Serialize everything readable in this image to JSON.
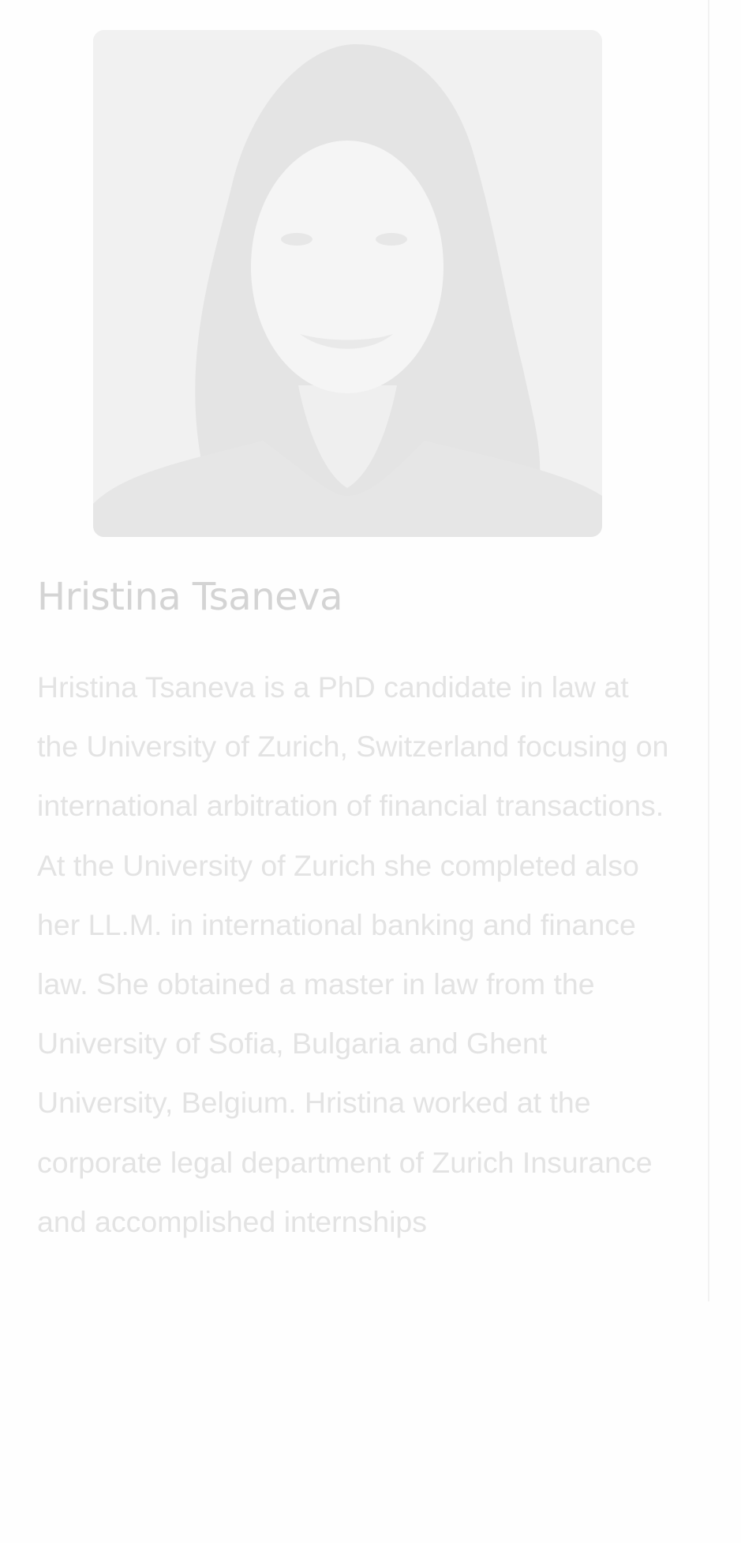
{
  "profile": {
    "photo_alt": "Portrait of Hristina Tsaneva",
    "name": "Hristina Tsaneva",
    "bio": "Hristina Tsaneva is a PhD candidate in law at the University of Zurich, Switzerland focusing on international arbitration of financial transactions. At the University of Zurich she completed also her LL.M. in international banking and finance law. She obtained a master in law from the University of Sofia, Bulgaria and Ghent University, Belgium. Hristina worked at the corporate legal department of Zurich Insurance and accomplished internships"
  }
}
